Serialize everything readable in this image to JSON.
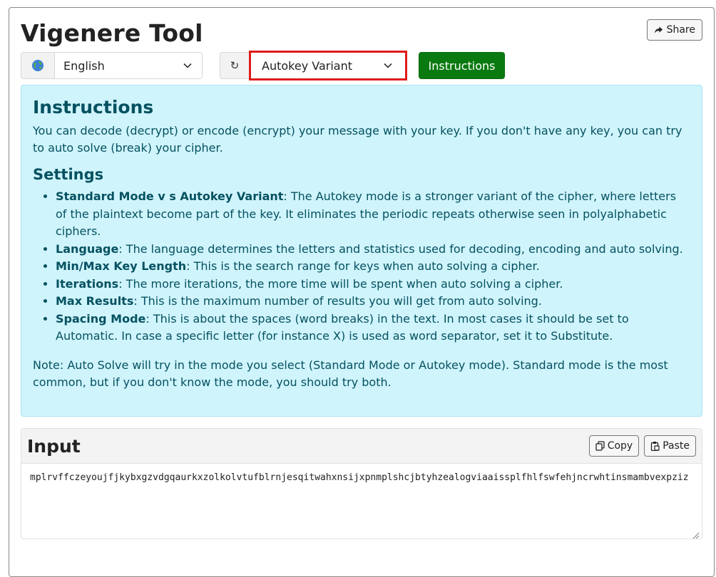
{
  "app": {
    "title": "Vigenere Tool",
    "share_label": "Share"
  },
  "toolbar": {
    "language": "English",
    "reset_glyph": "↻",
    "mode": "Autokey Variant",
    "instructions_label": "Instructions"
  },
  "instructions": {
    "heading": "Instructions",
    "intro": "You can decode (decrypt) or encode (encrypt) your message with your key. If you don't have any key, you can try to auto solve (break) your cipher.",
    "settings_heading": "Settings",
    "items": [
      {
        "term": "Standard Mode v s Autokey Variant",
        "desc": ": The Autokey mode is a stronger variant of the cipher, where letters of the plaintext become part of the key. It eliminates the periodic repeats otherwise seen in polyalphabetic ciphers."
      },
      {
        "term": "Language",
        "desc": ": The language determines the letters and statistics used for decoding, encoding and auto solving."
      },
      {
        "term": "Min/Max Key Length",
        "desc": ": This is the search range for keys when auto solving a cipher."
      },
      {
        "term": "Iterations",
        "desc": ": The more iterations, the more time will be spent when auto solving a cipher."
      },
      {
        "term": "Max Results",
        "desc": ": This is the maximum number of results you will get from auto solving."
      },
      {
        "term": "Spacing Mode",
        "desc": ": This is about the spaces (word breaks) in the text. In most cases it should be set to Automatic. In case a specific letter (for instance X) is used as word separator, set it to Substitute."
      }
    ],
    "note": "Note: Auto Solve will try in the mode you select (Standard Mode or Autokey mode). Standard mode is the most common, but if you don't know the mode, you should try both."
  },
  "input": {
    "heading": "Input",
    "copy_label": "Copy",
    "paste_label": "Paste",
    "value": "mplrvffczeyoujfjkybxgzvdgqaurkxzolkolvtufblrnjesqitwahxnsijxpnmplshcjbtyhzealogviaaissplfhlfswfehjncrwhtinsmambvexpziz"
  },
  "colors": {
    "info_bg": "#cff4fc",
    "info_text": "#055160",
    "primary_green": "#0a7a10",
    "highlight_red": "#e01b1b"
  }
}
